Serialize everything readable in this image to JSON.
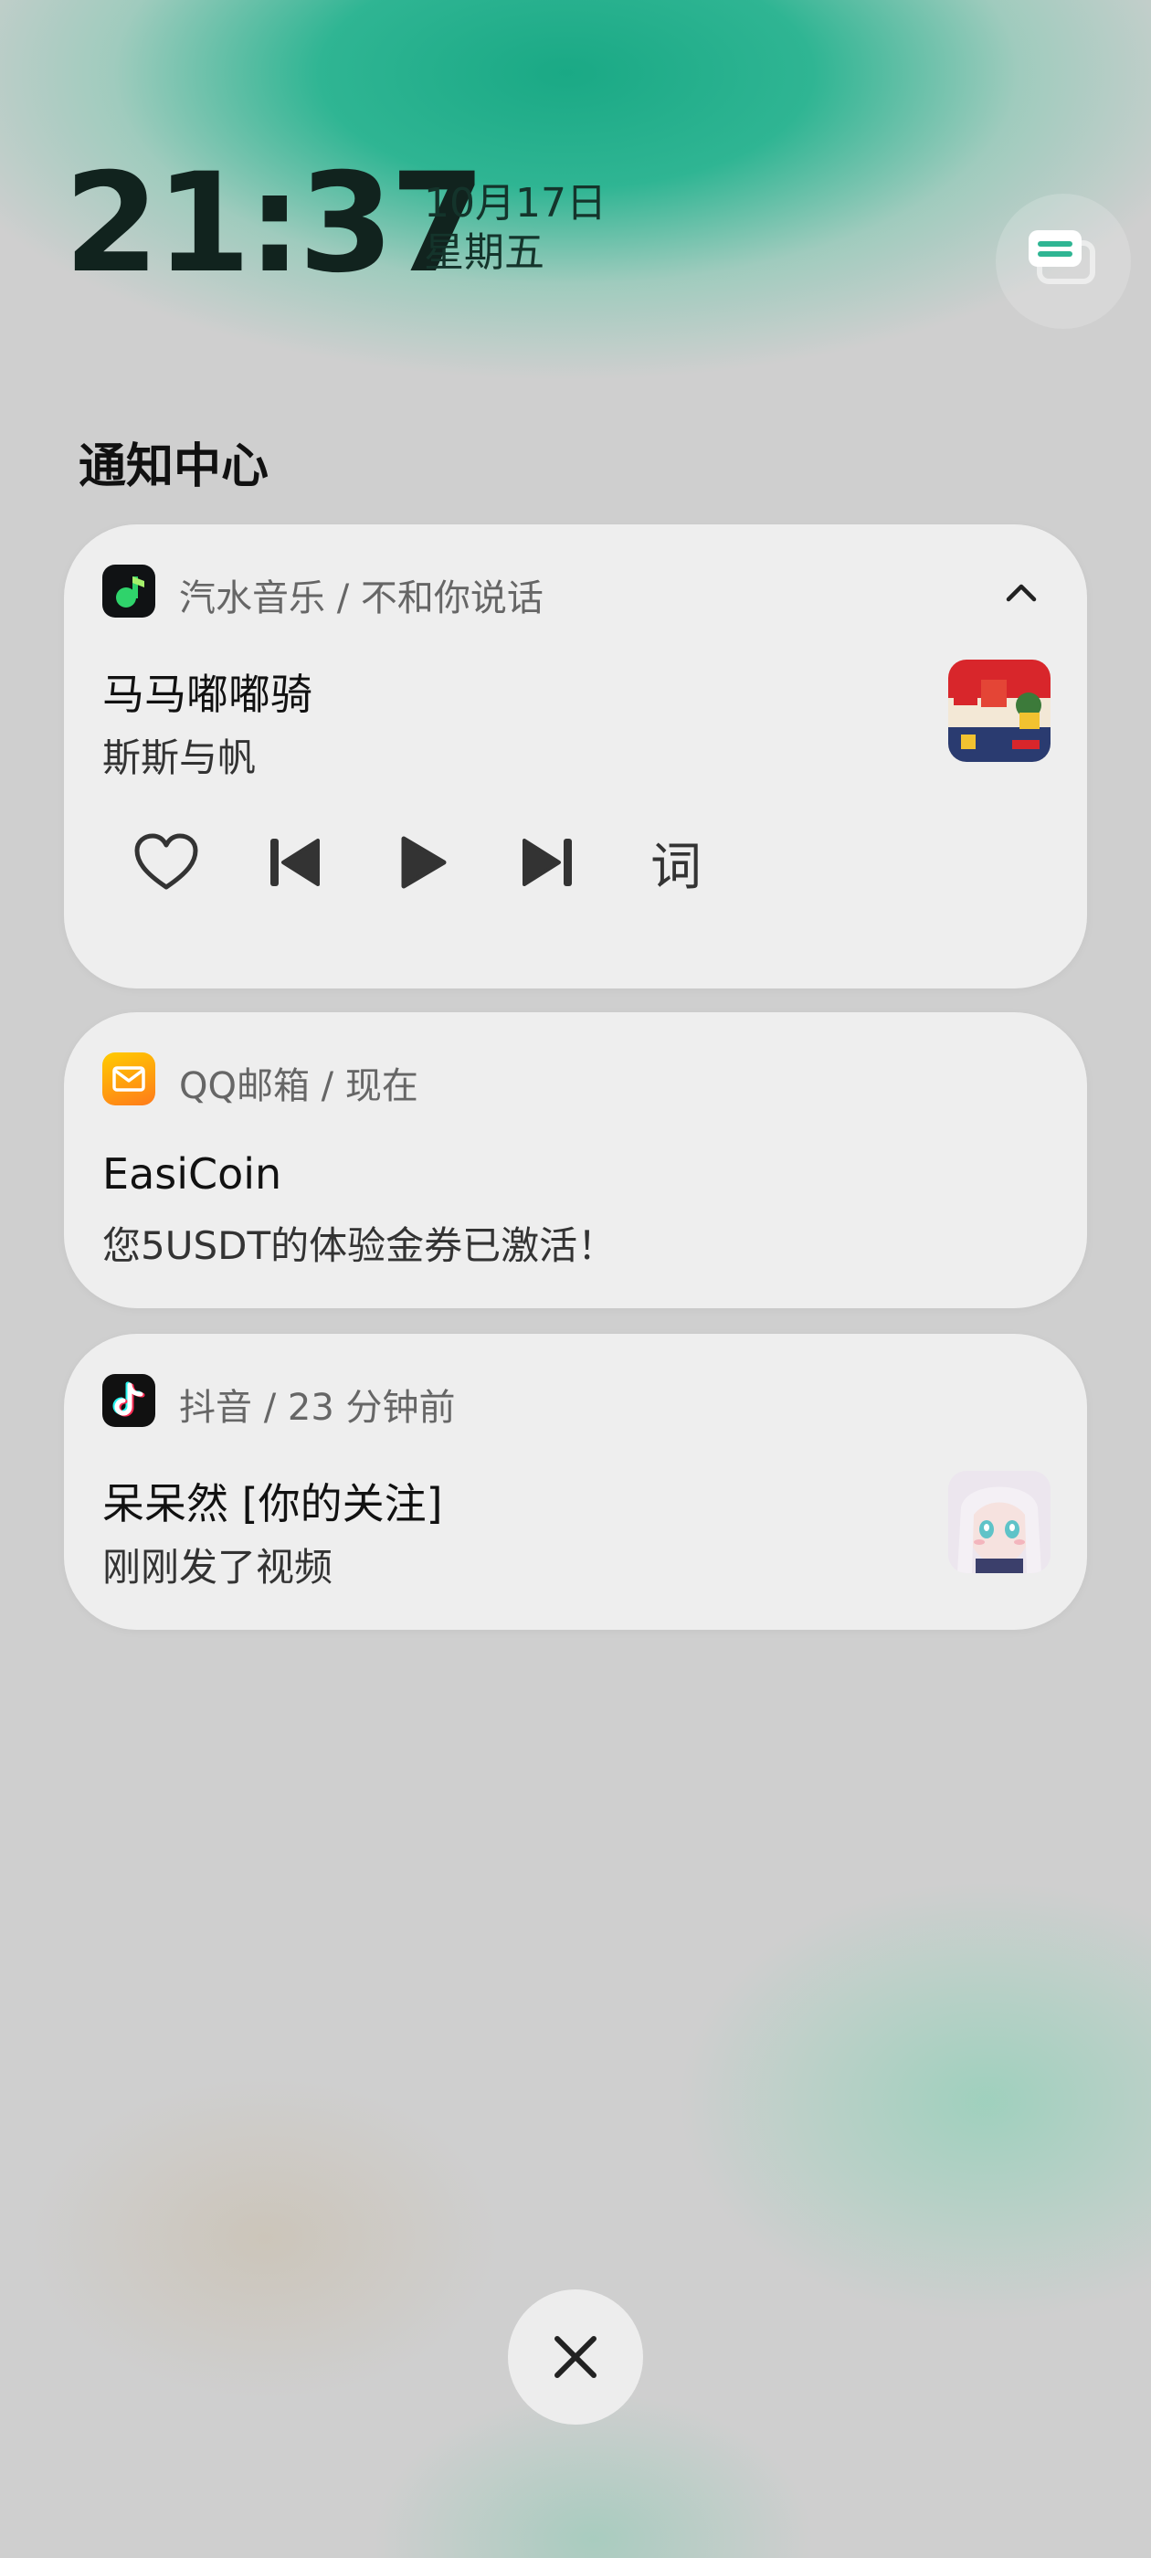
{
  "lockscreen": {
    "time": "21:37",
    "date": "10月17日",
    "weekday": "星期五",
    "top_right_icon": "notification-stack-icon"
  },
  "notification_center": {
    "title": "通知中心"
  },
  "notifications": {
    "music": {
      "app_icon": "music-note-icon",
      "header": "汽水音乐 / 不和你说话",
      "title": "马马嘟嘟骑",
      "subtitle": "斯斯与帆",
      "lyrics_label": "词",
      "controls": [
        "heart-icon",
        "previous-track-icon",
        "play-icon",
        "next-track-icon",
        "lyrics-button"
      ],
      "collapse_icon": "chevron-up-icon",
      "accent_colors": [
        "#d8262b",
        "#2a3b70",
        "#f2c230"
      ]
    },
    "mail": {
      "app_icon": "mail-envelope-icon",
      "header": "QQ邮箱 / 现在",
      "title": "EasiCoin",
      "subtitle": "您5USDT的体验金券已激活！",
      "icon_colors": [
        "#ffcc00",
        "#ff7a1a"
      ]
    },
    "douyin": {
      "app_icon": "tiktok-note-icon",
      "header": "抖音 / 23 分钟前",
      "title": "呆呆然 [你的关注]",
      "subtitle": "刚刚发了视频"
    }
  },
  "close_button": {
    "icon": "close-icon"
  }
}
